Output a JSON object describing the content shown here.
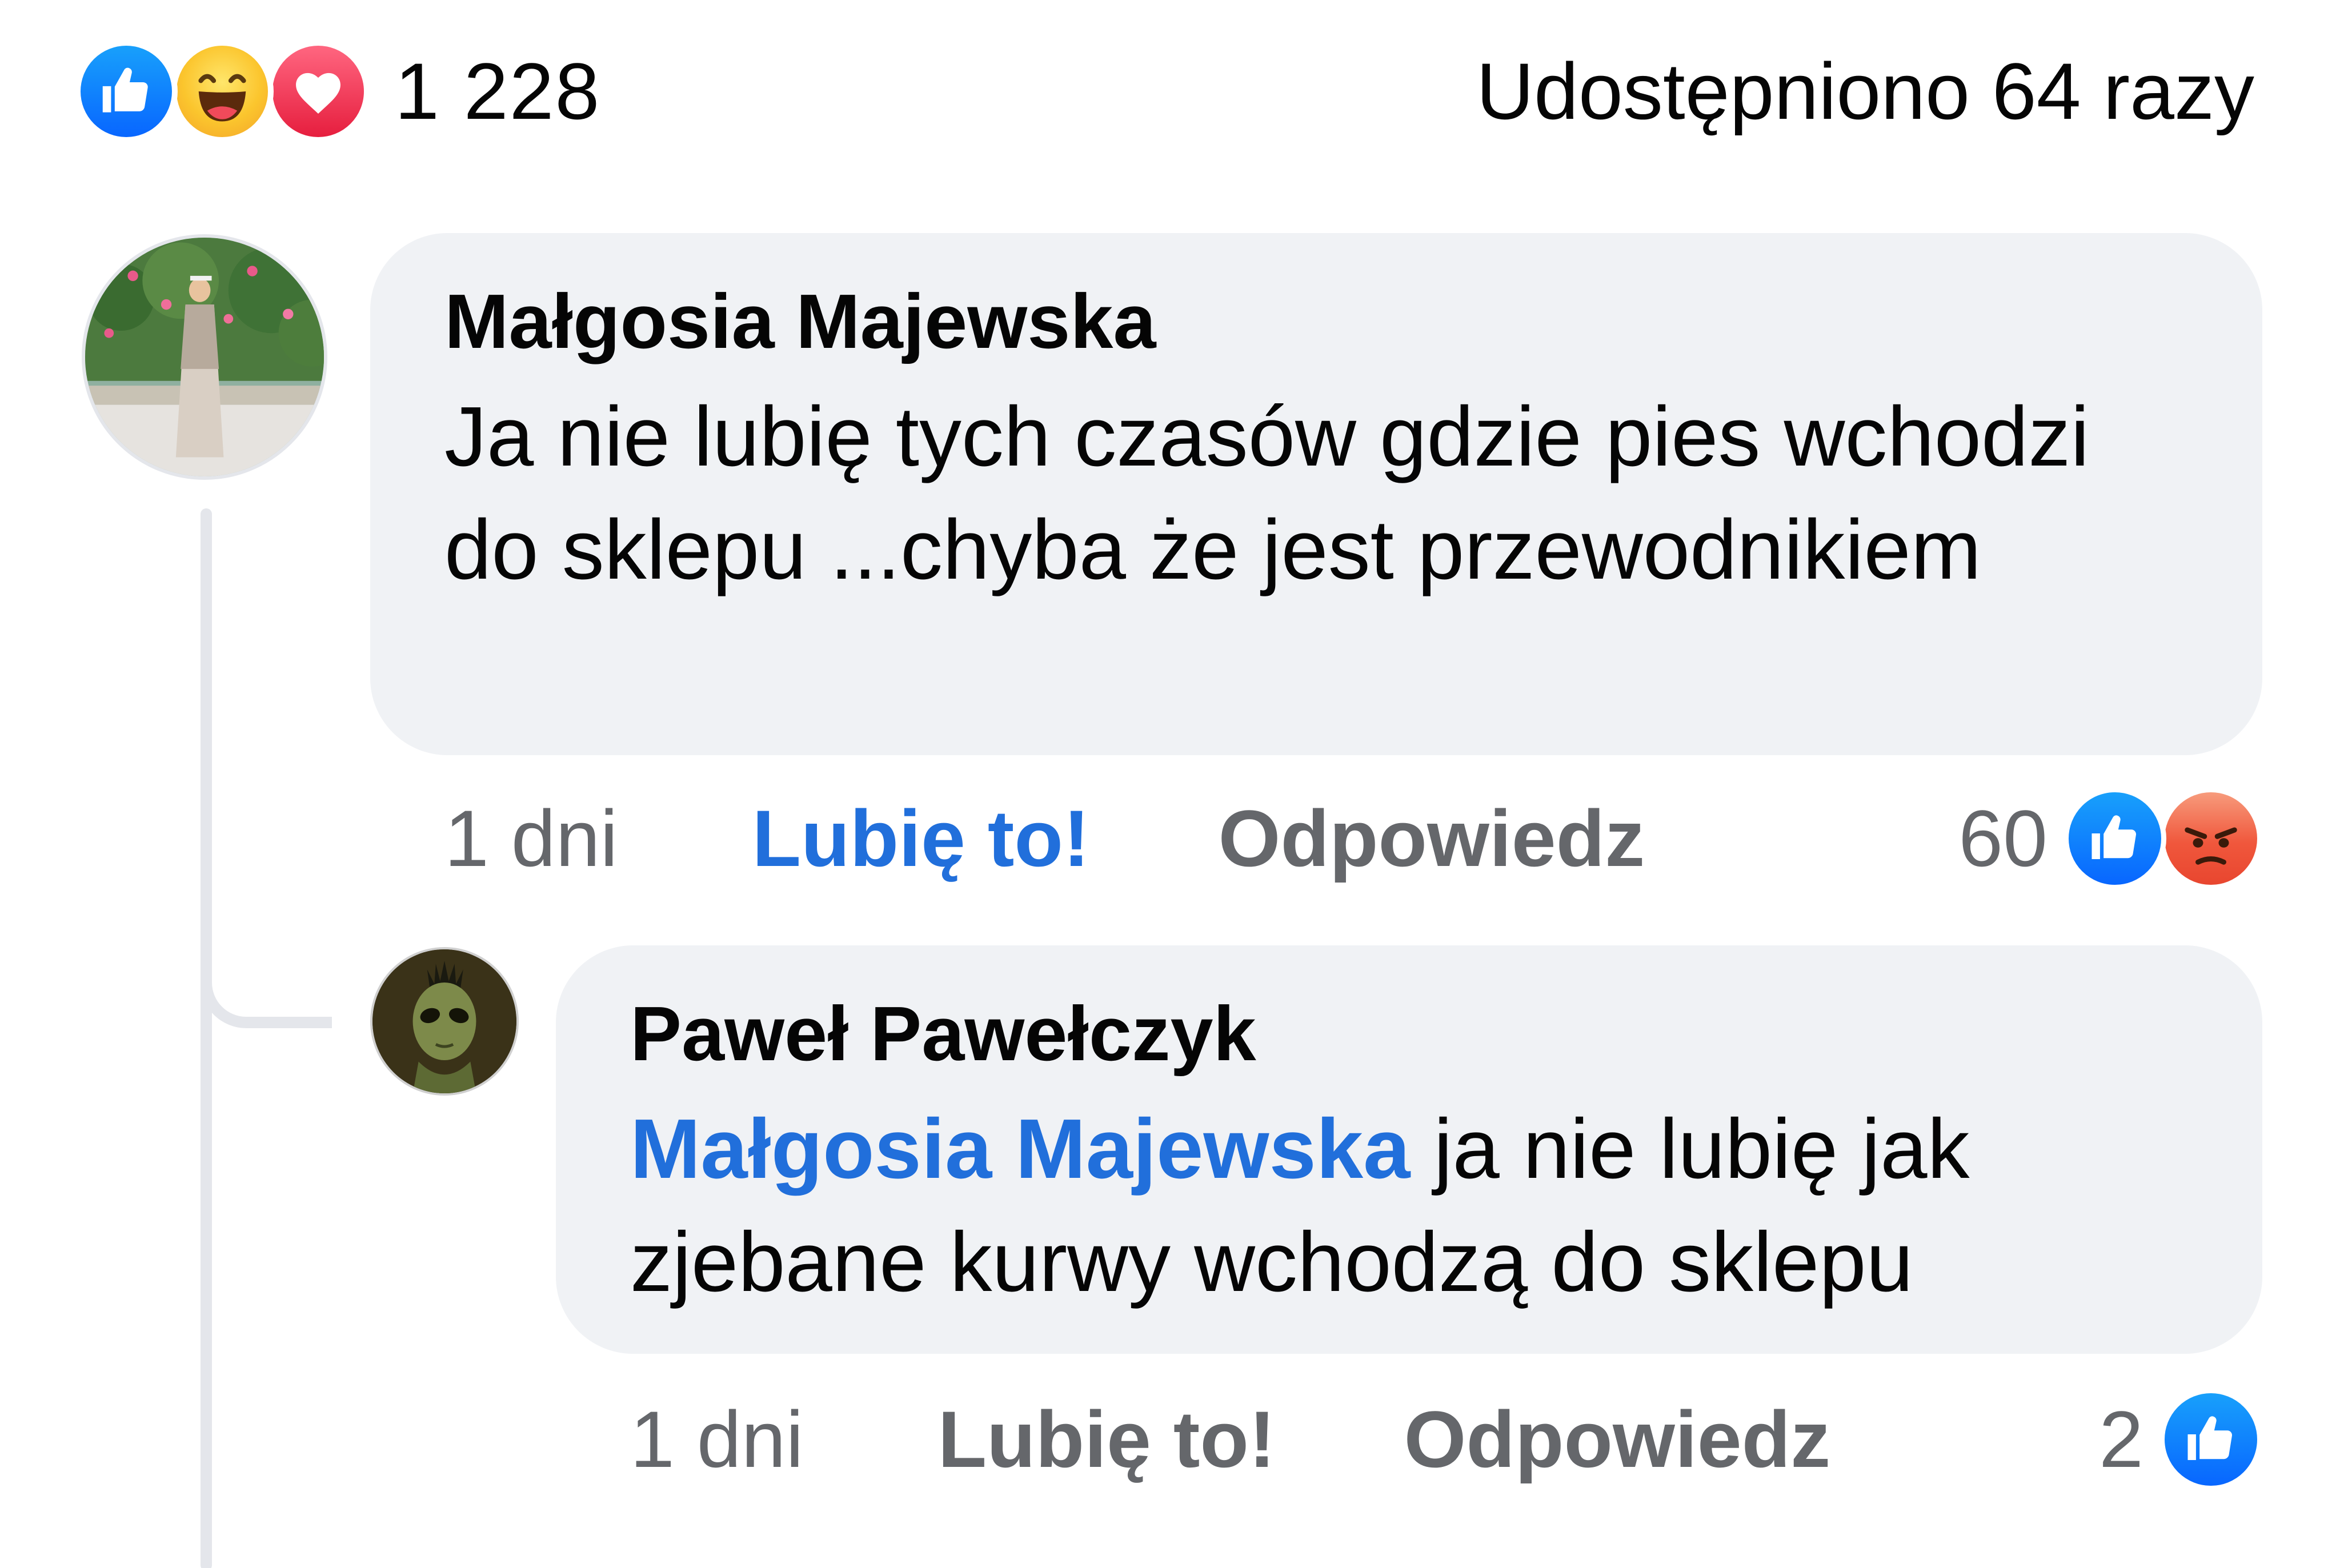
{
  "post_summary": {
    "reaction_icons": [
      "like-icon",
      "haha-icon",
      "love-icon"
    ],
    "reaction_count": "1 228",
    "shares_label": "Udostępniono 64 razy"
  },
  "comments": [
    {
      "author": "Małgosia Majewska",
      "text": "Ja nie lubię tych czasów gdzie pies wchodzi do sklepu ...chyba że jest przewodnikiem",
      "time": "1 dni",
      "like_label": "Lubię to!",
      "like_active": true,
      "reply_label": "Odpowiedz",
      "reaction_count": "60",
      "reaction_icons": [
        "like-icon",
        "angry-icon"
      ]
    },
    {
      "author": "Paweł Pawełczyk",
      "mention": "Małgosia Majewska",
      "text": " ja nie lubię jak zjebane kurwy wchodzą do sklepu",
      "time": "1 dni",
      "like_label": "Lubię to!",
      "like_active": false,
      "reply_label": "Odpowiedz",
      "reaction_count": "2",
      "reaction_icons": [
        "like-icon"
      ]
    }
  ],
  "colors": {
    "bubble_bg": "#f0f2f5",
    "link_blue": "#216fdb",
    "secondary_text": "#65676b",
    "like_blue": "#0866ff",
    "thread_line": "#e4e6eb"
  }
}
